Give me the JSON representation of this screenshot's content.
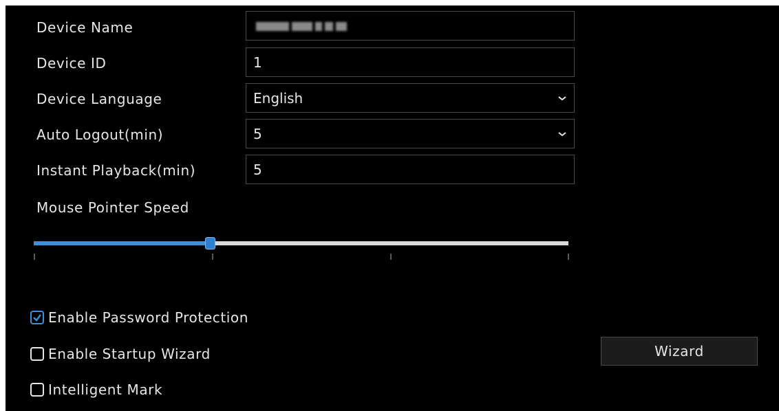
{
  "form": {
    "device_name": {
      "label": "Device Name",
      "value": ""
    },
    "device_id": {
      "label": "Device ID",
      "value": "1"
    },
    "device_language": {
      "label": "Device Language",
      "value": "English"
    },
    "auto_logout": {
      "label": "Auto Logout(min)",
      "value": "5"
    },
    "instant_playback": {
      "label": "Instant Playback(min)",
      "value": "5"
    },
    "mouse_pointer_speed": {
      "label": "Mouse Pointer Speed",
      "level": 0.33
    }
  },
  "options": {
    "password_protection": {
      "label": "Enable Password Protection",
      "checked": true
    },
    "startup_wizard": {
      "label": "Enable Startup Wizard",
      "checked": false
    },
    "intelligent_mark": {
      "label": "Intelligent Mark",
      "checked": false
    }
  },
  "buttons": {
    "wizard": "Wizard"
  },
  "icons": {
    "dropdown": "chevron-down-icon",
    "checkbox_checked": "checkmark-icon"
  },
  "colors": {
    "accent": "#3d8fd9",
    "background": "#000000",
    "text": "#e6e6e6"
  }
}
